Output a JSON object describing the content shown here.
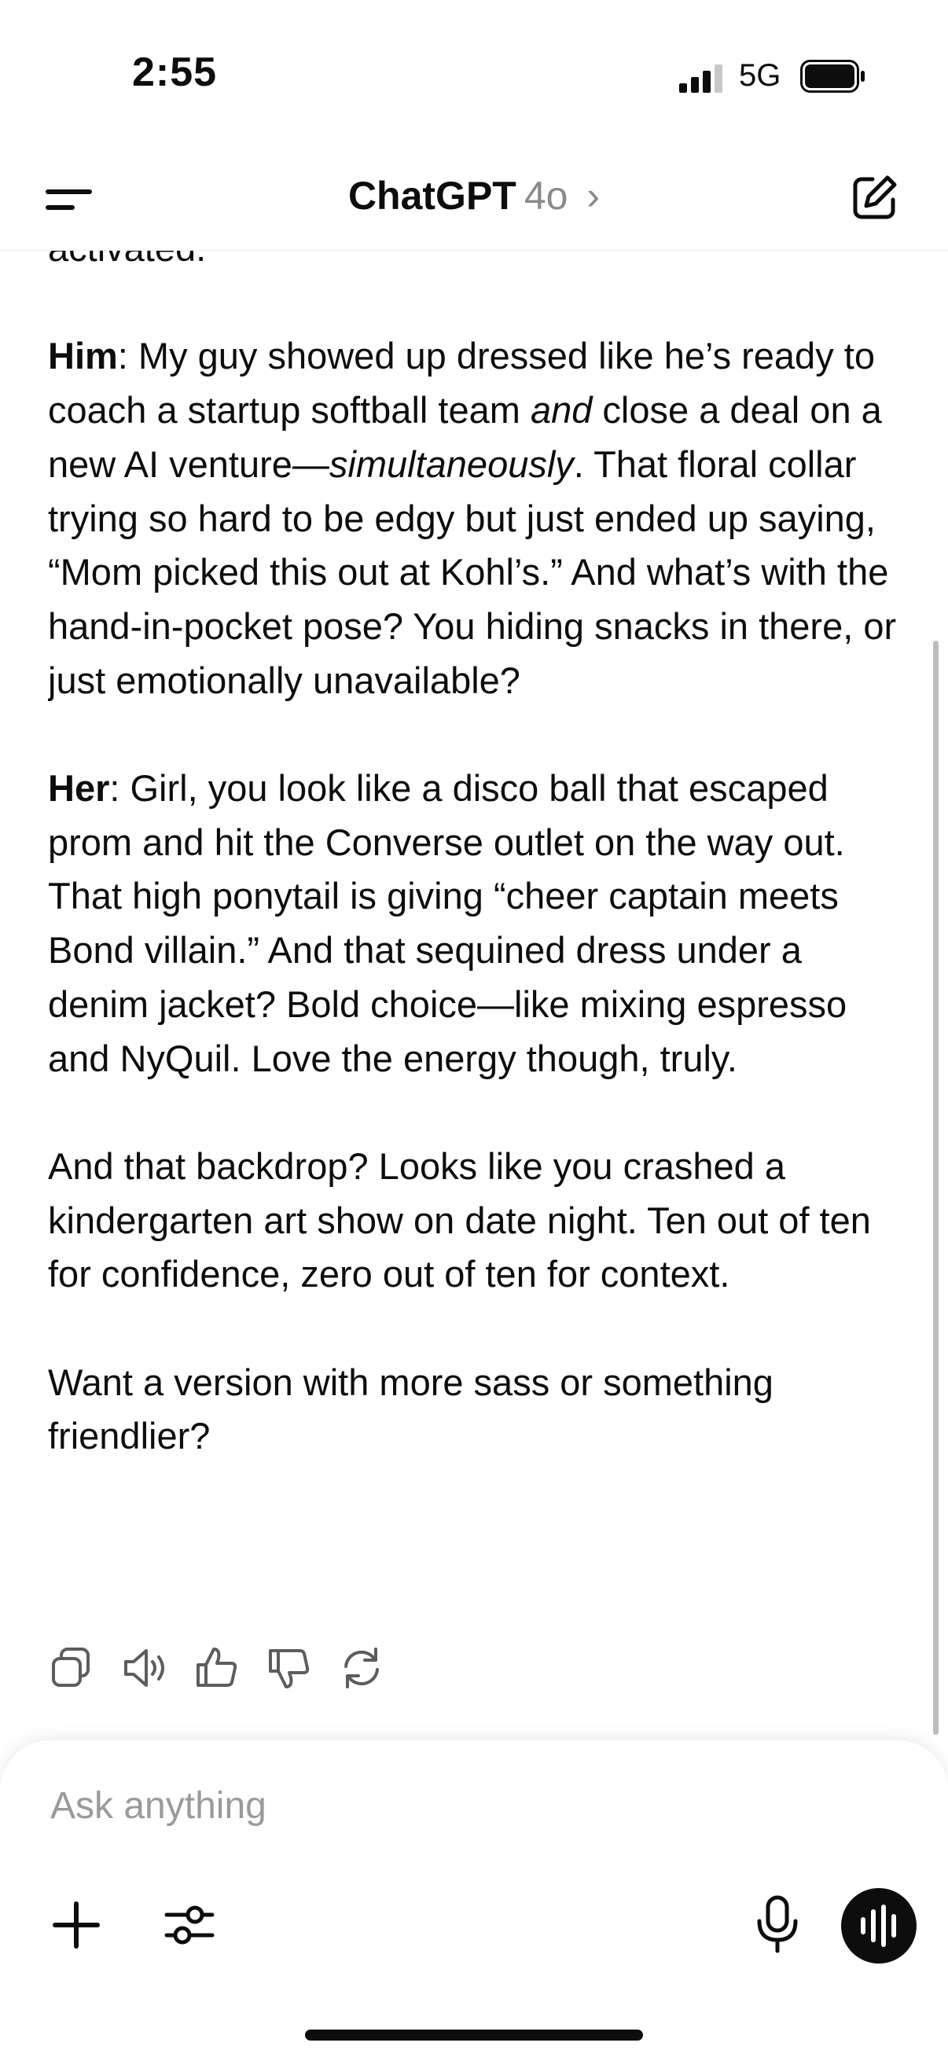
{
  "status_bar": {
    "time": "2:55",
    "network": "5G",
    "signal_bars": 3,
    "signal_bars_total": 4
  },
  "nav": {
    "app_name": "ChatGPT",
    "model": "4o",
    "chevron": "›"
  },
  "message": {
    "intro": "activated.",
    "him_label": "Him",
    "him_part1": ": My guy showed up dressed like he’s ready to coach a startup softball team ",
    "him_em1": "and",
    "him_part2": " close a deal on a new AI venture—",
    "him_em2": "simultaneously",
    "him_part3": ". That floral collar trying so hard to be edgy but just ended up saying, “Mom picked this out at Kohl’s.” And what’s with the hand-in-pocket pose? You hiding snacks in there, or just emotionally unavailable?",
    "her_label": "Her",
    "her_text": ": Girl, you look like a disco ball that escaped prom and hit the Converse outlet on the way out. That high ponytail is giving “cheer captain meets Bond villain.” And that sequined dress under a denim jacket? Bold choice—like mixing espresso and NyQuil. Love the energy though, truly.",
    "backdrop": "And that backdrop? Looks like you crashed a kindergarten art show on date night. Ten out of ten for confidence, zero out of ten for context.",
    "followup": "Want a version with more sass or something friendlier?"
  },
  "message_actions": [
    "copy-icon",
    "read-aloud-icon",
    "thumbs-up-icon",
    "thumbs-down-icon",
    "regenerate-icon"
  ],
  "composer": {
    "placeholder": "Ask anything",
    "value": ""
  },
  "colors": {
    "text": "#0d0d0d",
    "muted": "#8a8a8a",
    "icon": "#5d5d5d",
    "scrollbar": "#bdbdbd"
  }
}
